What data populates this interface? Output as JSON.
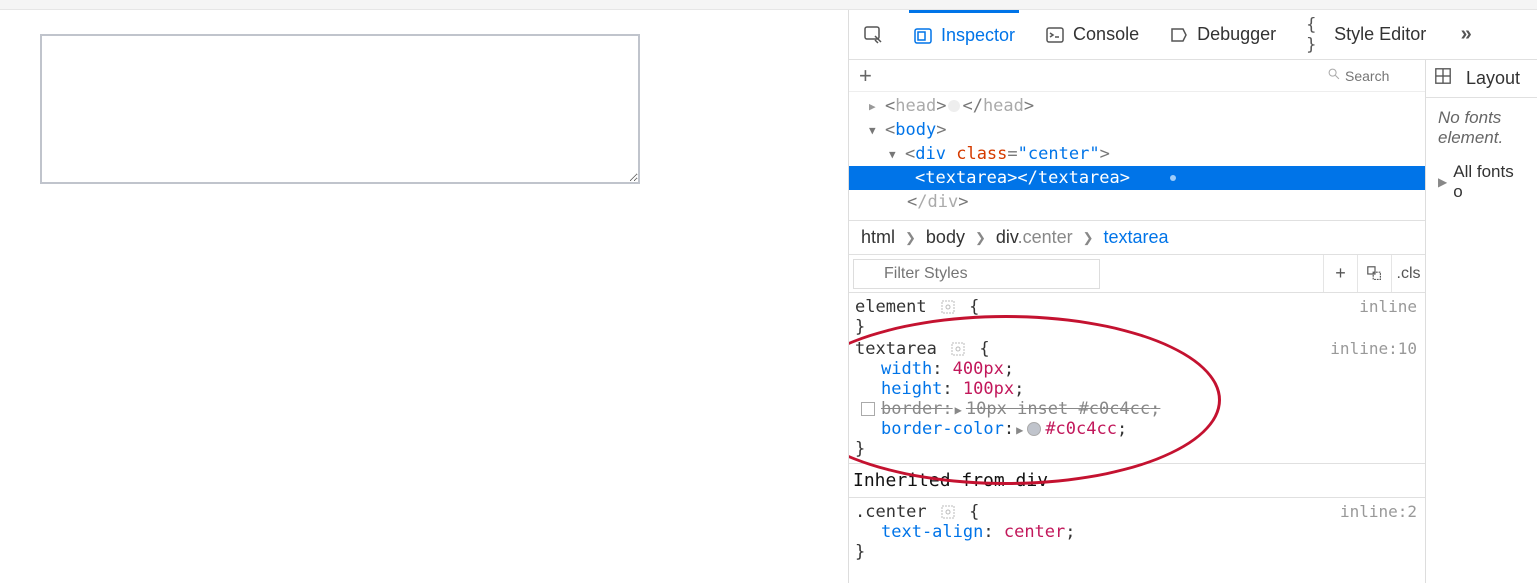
{
  "tabs": {
    "inspector": "Inspector",
    "console": "Console",
    "debugger": "Debugger",
    "style_editor": "Style Editor"
  },
  "markup": {
    "search_placeholder": "Search",
    "head_row": "<head>…</head>",
    "body_open": "body",
    "div_tag": "div",
    "div_attr_name": "class",
    "div_attr_value": "center",
    "textarea_open": "textarea",
    "textarea_close": "textarea",
    "div_close": "/div"
  },
  "breadcrumbs": {
    "a": "html",
    "b": "body",
    "c_tag": "div",
    "c_cls": ".center",
    "d": "textarea"
  },
  "styles": {
    "filter_placeholder": "Filter Styles",
    "cls": ".cls",
    "rule0": {
      "selector": "element",
      "src": "inline"
    },
    "rule1": {
      "selector": "textarea",
      "src": "inline:10",
      "d0p": "width",
      "d0v": "400px",
      "d1p": "height",
      "d1v": "100px",
      "d2p": "border",
      "d2v": "10px inset #c0c4cc",
      "d3p": "border-color",
      "d3v": "#c0c4cc"
    },
    "inherited": "Inherited from div",
    "rule2": {
      "selector": ".center",
      "src": "inline:2",
      "d0p": "text-align",
      "d0v": "center"
    }
  },
  "right": {
    "layout": "Layout",
    "msg1": "No fonts",
    "msg2": "element.",
    "allfonts": "All fonts o"
  }
}
